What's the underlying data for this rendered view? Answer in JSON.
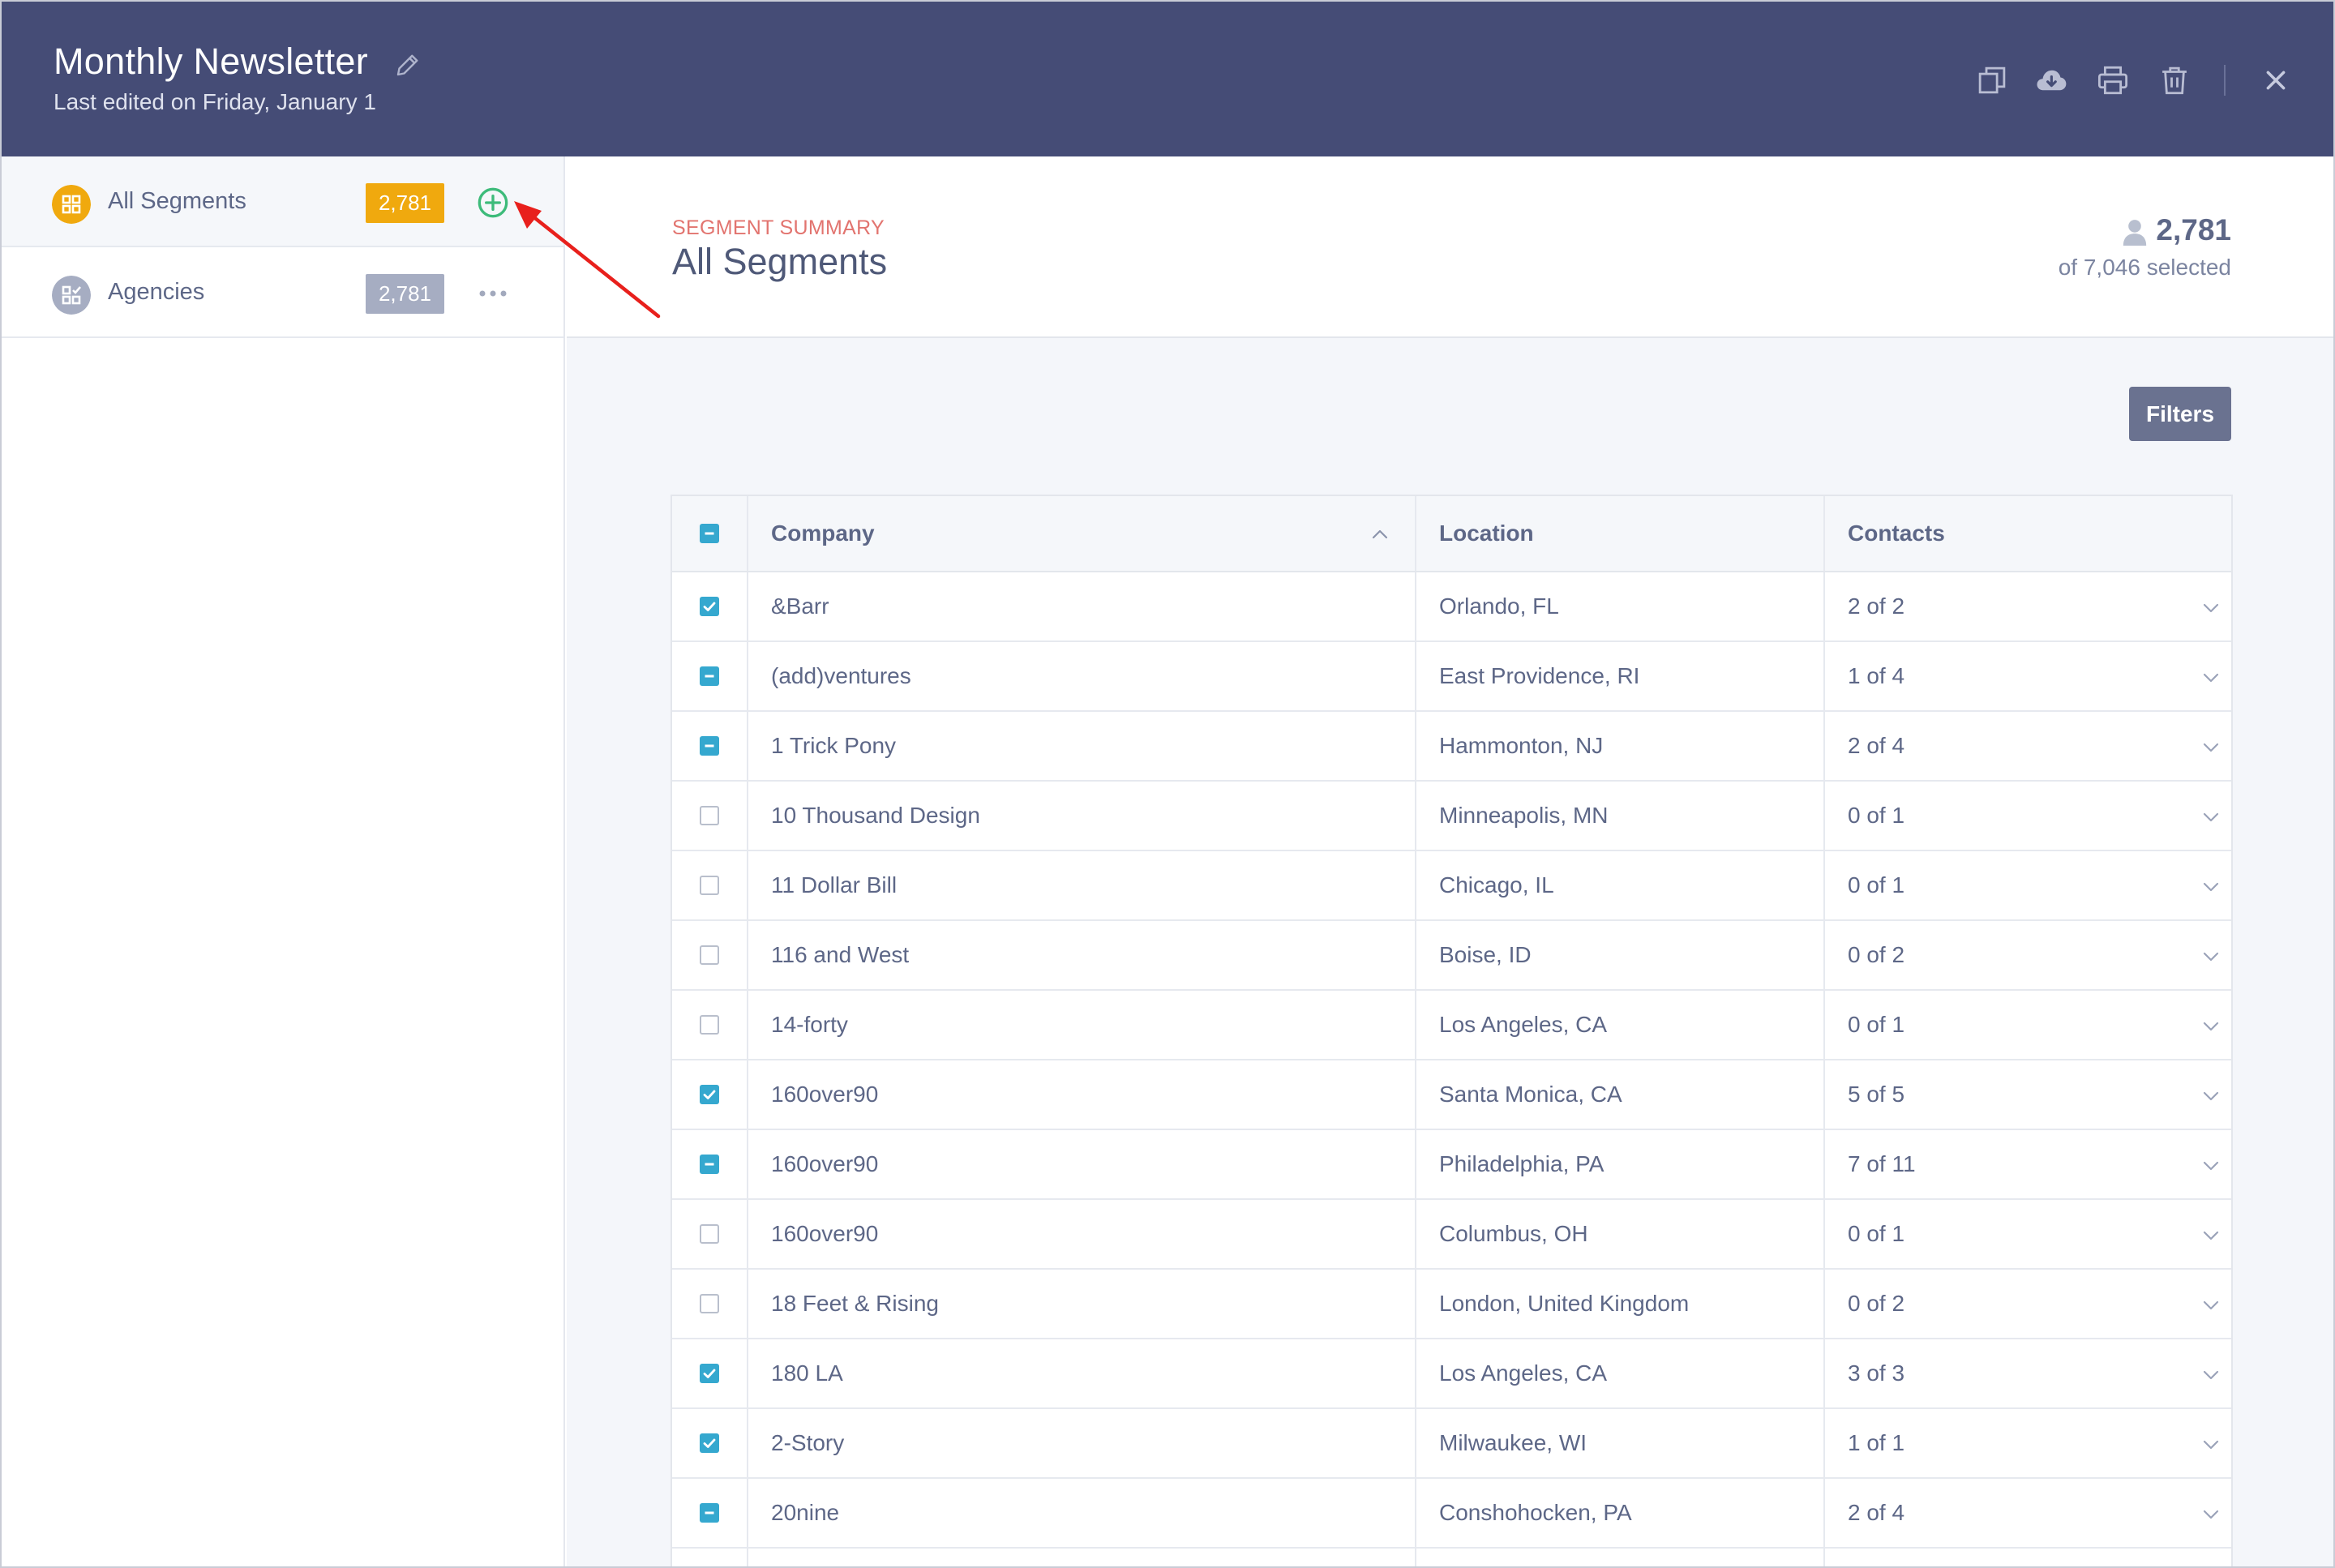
{
  "header": {
    "title": "Monthly Newsletter",
    "subtitle": "Last edited on Friday, January 1",
    "actions": [
      "duplicate-icon",
      "download-icon",
      "print-icon",
      "trash-icon",
      "close-icon"
    ]
  },
  "sidebar": {
    "segments": [
      {
        "label": "All Segments",
        "count": "2,781",
        "active": true,
        "icon": "grid-icon",
        "color": "#f0a90e"
      },
      {
        "label": "Agencies",
        "count": "2,781",
        "active": false,
        "icon": "checklist-grid-icon",
        "color": "#a6adc2"
      }
    ]
  },
  "summary": {
    "eyebrow": "SEGMENT SUMMARY",
    "title": "All Segments",
    "selected_count": "2,781",
    "selected_of": "of 7,046 selected"
  },
  "toolbar": {
    "filters_label": "Filters"
  },
  "table": {
    "headers": {
      "company": "Company",
      "location": "Location",
      "contacts": "Contacts"
    },
    "header_check": "partial",
    "rows": [
      {
        "check": "on",
        "company": "&Barr",
        "location": "Orlando, FL",
        "contacts": "2 of 2"
      },
      {
        "check": "partial",
        "company": "(add)ventures",
        "location": "East Providence, RI",
        "contacts": "1 of 4"
      },
      {
        "check": "partial",
        "company": "1 Trick Pony",
        "location": "Hammonton, NJ",
        "contacts": "2 of 4"
      },
      {
        "check": "off",
        "company": "10 Thousand Design",
        "location": "Minneapolis, MN",
        "contacts": "0 of 1"
      },
      {
        "check": "off",
        "company": "11 Dollar Bill",
        "location": "Chicago, IL",
        "contacts": "0 of 1"
      },
      {
        "check": "off",
        "company": "116 and West",
        "location": "Boise, ID",
        "contacts": "0 of 2"
      },
      {
        "check": "off",
        "company": "14-forty",
        "location": "Los Angeles, CA",
        "contacts": "0 of 1"
      },
      {
        "check": "on",
        "company": "160over90",
        "location": "Santa Monica, CA",
        "contacts": "5 of 5"
      },
      {
        "check": "partial",
        "company": "160over90",
        "location": "Philadelphia, PA",
        "contacts": "7 of 11"
      },
      {
        "check": "off",
        "company": "160over90",
        "location": "Columbus, OH",
        "contacts": "0 of 1"
      },
      {
        "check": "off",
        "company": "18 Feet & Rising",
        "location": "London, United Kingdom",
        "contacts": "0 of 2"
      },
      {
        "check": "on",
        "company": "180 LA",
        "location": "Los Angeles, CA",
        "contacts": "3 of 3"
      },
      {
        "check": "on",
        "company": "2-Story",
        "location": "Milwaukee, WI",
        "contacts": "1 of 1"
      },
      {
        "check": "partial",
        "company": "20nine",
        "location": "Conshohocken, PA",
        "contacts": "2 of 4"
      },
      {
        "check": "off",
        "company": "",
        "location": "",
        "contacts": ""
      }
    ]
  },
  "colors": {
    "header_bg": "#454c76",
    "accent_checkbox": "#35a8cf",
    "eyebrow": "#e2746f",
    "add_icon": "#3dbb7a",
    "annotation_arrow": "#e8201c"
  }
}
